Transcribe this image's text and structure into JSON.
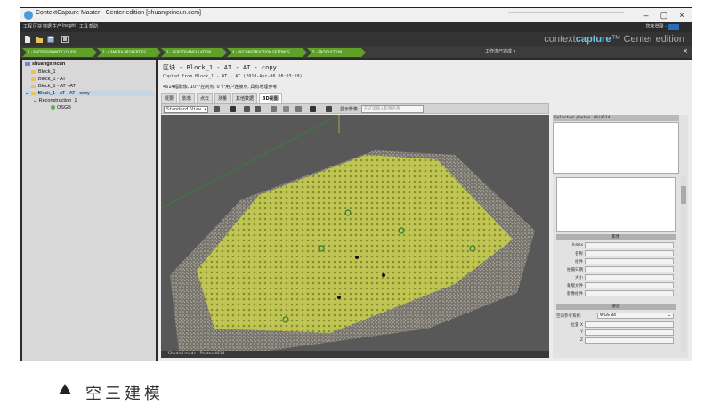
{
  "window": {
    "title": "ContextCapture Master - Center edition [shuangxincun.ccm]",
    "minimize": "–",
    "maximize": "▢",
    "close": "×"
  },
  "menu": {
    "items": [
      "工程",
      "区块",
      "数据",
      "生产",
      "Insight",
      "工具",
      "帮助"
    ],
    "login": "您未登录 -"
  },
  "brand": {
    "prefix": "context",
    "highlight": "capture",
    "suffix": "™ Center edition"
  },
  "workflow": {
    "steps": [
      "1 · PHOTOS/POINT CLOUDS",
      "2 · CAMERA PROPERTIES",
      "3 · AEROTRIANGULATION",
      "4 · RECONSTRUCTION SETTINGS",
      "5 · PRODUCTION"
    ],
    "job_queue": "工作流已完成 ▾",
    "close": "×"
  },
  "tree": {
    "project": "shuangxincun",
    "items": [
      "Block_1",
      "Block_1 - AT",
      "Block_1 - AT - AT",
      "Block_1 - AT - AT - copy",
      "Reconstruction_1",
      "OSGB"
    ]
  },
  "main": {
    "title": "区块 - Block_1 - AT - AT - copy",
    "copied": "Copied from Block_1 - AT - AT (2019-Apr-08 08:03:19)",
    "summary": "4614幅影像, 10个控制点, 0 个用户连接点, 具有地理参考",
    "tabs": [
      "概要",
      "影像",
      "点云",
      "测量",
      "其他数据",
      "3D视图"
    ],
    "active_tab": 5
  },
  "viewtb": {
    "view_select": "Standard View ▾",
    "show_images": "显示影像",
    "search_placeholder": "在这里输入影像名称"
  },
  "status": {
    "text": "Shaded mode | Photos 4614"
  },
  "rpanel": {
    "selected_photos": "Selected photos (0/4614)",
    "image_section": "影像",
    "image_fields": [
      "Index",
      "名称",
      "组件",
      "拍摄日期",
      "大小",
      "蒙版文件",
      "影像组件"
    ],
    "pose_section": "姿态",
    "srs_label": "空间参考系统:",
    "srs_value": "WGS 84",
    "pose_fields": [
      "位置 X",
      "Y",
      "Z"
    ]
  },
  "caption": {
    "marker": "▲",
    "text": "空三建模"
  }
}
